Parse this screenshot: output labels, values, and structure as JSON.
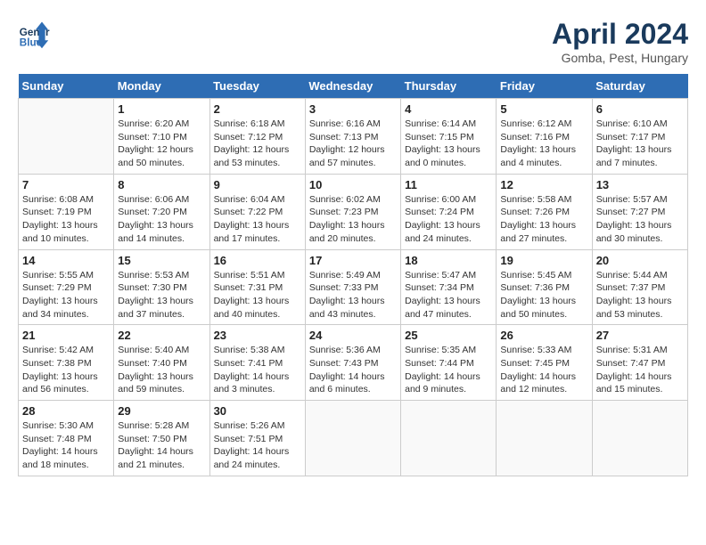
{
  "header": {
    "logo_line1": "General",
    "logo_line2": "Blue",
    "month_title": "April 2024",
    "location": "Gomba, Pest, Hungary"
  },
  "days_of_week": [
    "Sunday",
    "Monday",
    "Tuesday",
    "Wednesday",
    "Thursday",
    "Friday",
    "Saturday"
  ],
  "weeks": [
    [
      {
        "day": "",
        "sunrise": "",
        "sunset": "",
        "daylight": ""
      },
      {
        "day": "1",
        "sunrise": "Sunrise: 6:20 AM",
        "sunset": "Sunset: 7:10 PM",
        "daylight": "Daylight: 12 hours and 50 minutes."
      },
      {
        "day": "2",
        "sunrise": "Sunrise: 6:18 AM",
        "sunset": "Sunset: 7:12 PM",
        "daylight": "Daylight: 12 hours and 53 minutes."
      },
      {
        "day": "3",
        "sunrise": "Sunrise: 6:16 AM",
        "sunset": "Sunset: 7:13 PM",
        "daylight": "Daylight: 12 hours and 57 minutes."
      },
      {
        "day": "4",
        "sunrise": "Sunrise: 6:14 AM",
        "sunset": "Sunset: 7:15 PM",
        "daylight": "Daylight: 13 hours and 0 minutes."
      },
      {
        "day": "5",
        "sunrise": "Sunrise: 6:12 AM",
        "sunset": "Sunset: 7:16 PM",
        "daylight": "Daylight: 13 hours and 4 minutes."
      },
      {
        "day": "6",
        "sunrise": "Sunrise: 6:10 AM",
        "sunset": "Sunset: 7:17 PM",
        "daylight": "Daylight: 13 hours and 7 minutes."
      }
    ],
    [
      {
        "day": "7",
        "sunrise": "Sunrise: 6:08 AM",
        "sunset": "Sunset: 7:19 PM",
        "daylight": "Daylight: 13 hours and 10 minutes."
      },
      {
        "day": "8",
        "sunrise": "Sunrise: 6:06 AM",
        "sunset": "Sunset: 7:20 PM",
        "daylight": "Daylight: 13 hours and 14 minutes."
      },
      {
        "day": "9",
        "sunrise": "Sunrise: 6:04 AM",
        "sunset": "Sunset: 7:22 PM",
        "daylight": "Daylight: 13 hours and 17 minutes."
      },
      {
        "day": "10",
        "sunrise": "Sunrise: 6:02 AM",
        "sunset": "Sunset: 7:23 PM",
        "daylight": "Daylight: 13 hours and 20 minutes."
      },
      {
        "day": "11",
        "sunrise": "Sunrise: 6:00 AM",
        "sunset": "Sunset: 7:24 PM",
        "daylight": "Daylight: 13 hours and 24 minutes."
      },
      {
        "day": "12",
        "sunrise": "Sunrise: 5:58 AM",
        "sunset": "Sunset: 7:26 PM",
        "daylight": "Daylight: 13 hours and 27 minutes."
      },
      {
        "day": "13",
        "sunrise": "Sunrise: 5:57 AM",
        "sunset": "Sunset: 7:27 PM",
        "daylight": "Daylight: 13 hours and 30 minutes."
      }
    ],
    [
      {
        "day": "14",
        "sunrise": "Sunrise: 5:55 AM",
        "sunset": "Sunset: 7:29 PM",
        "daylight": "Daylight: 13 hours and 34 minutes."
      },
      {
        "day": "15",
        "sunrise": "Sunrise: 5:53 AM",
        "sunset": "Sunset: 7:30 PM",
        "daylight": "Daylight: 13 hours and 37 minutes."
      },
      {
        "day": "16",
        "sunrise": "Sunrise: 5:51 AM",
        "sunset": "Sunset: 7:31 PM",
        "daylight": "Daylight: 13 hours and 40 minutes."
      },
      {
        "day": "17",
        "sunrise": "Sunrise: 5:49 AM",
        "sunset": "Sunset: 7:33 PM",
        "daylight": "Daylight: 13 hours and 43 minutes."
      },
      {
        "day": "18",
        "sunrise": "Sunrise: 5:47 AM",
        "sunset": "Sunset: 7:34 PM",
        "daylight": "Daylight: 13 hours and 47 minutes."
      },
      {
        "day": "19",
        "sunrise": "Sunrise: 5:45 AM",
        "sunset": "Sunset: 7:36 PM",
        "daylight": "Daylight: 13 hours and 50 minutes."
      },
      {
        "day": "20",
        "sunrise": "Sunrise: 5:44 AM",
        "sunset": "Sunset: 7:37 PM",
        "daylight": "Daylight: 13 hours and 53 minutes."
      }
    ],
    [
      {
        "day": "21",
        "sunrise": "Sunrise: 5:42 AM",
        "sunset": "Sunset: 7:38 PM",
        "daylight": "Daylight: 13 hours and 56 minutes."
      },
      {
        "day": "22",
        "sunrise": "Sunrise: 5:40 AM",
        "sunset": "Sunset: 7:40 PM",
        "daylight": "Daylight: 13 hours and 59 minutes."
      },
      {
        "day": "23",
        "sunrise": "Sunrise: 5:38 AM",
        "sunset": "Sunset: 7:41 PM",
        "daylight": "Daylight: 14 hours and 3 minutes."
      },
      {
        "day": "24",
        "sunrise": "Sunrise: 5:36 AM",
        "sunset": "Sunset: 7:43 PM",
        "daylight": "Daylight: 14 hours and 6 minutes."
      },
      {
        "day": "25",
        "sunrise": "Sunrise: 5:35 AM",
        "sunset": "Sunset: 7:44 PM",
        "daylight": "Daylight: 14 hours and 9 minutes."
      },
      {
        "day": "26",
        "sunrise": "Sunrise: 5:33 AM",
        "sunset": "Sunset: 7:45 PM",
        "daylight": "Daylight: 14 hours and 12 minutes."
      },
      {
        "day": "27",
        "sunrise": "Sunrise: 5:31 AM",
        "sunset": "Sunset: 7:47 PM",
        "daylight": "Daylight: 14 hours and 15 minutes."
      }
    ],
    [
      {
        "day": "28",
        "sunrise": "Sunrise: 5:30 AM",
        "sunset": "Sunset: 7:48 PM",
        "daylight": "Daylight: 14 hours and 18 minutes."
      },
      {
        "day": "29",
        "sunrise": "Sunrise: 5:28 AM",
        "sunset": "Sunset: 7:50 PM",
        "daylight": "Daylight: 14 hours and 21 minutes."
      },
      {
        "day": "30",
        "sunrise": "Sunrise: 5:26 AM",
        "sunset": "Sunset: 7:51 PM",
        "daylight": "Daylight: 14 hours and 24 minutes."
      },
      {
        "day": "",
        "sunrise": "",
        "sunset": "",
        "daylight": ""
      },
      {
        "day": "",
        "sunrise": "",
        "sunset": "",
        "daylight": ""
      },
      {
        "day": "",
        "sunrise": "",
        "sunset": "",
        "daylight": ""
      },
      {
        "day": "",
        "sunrise": "",
        "sunset": "",
        "daylight": ""
      }
    ]
  ]
}
